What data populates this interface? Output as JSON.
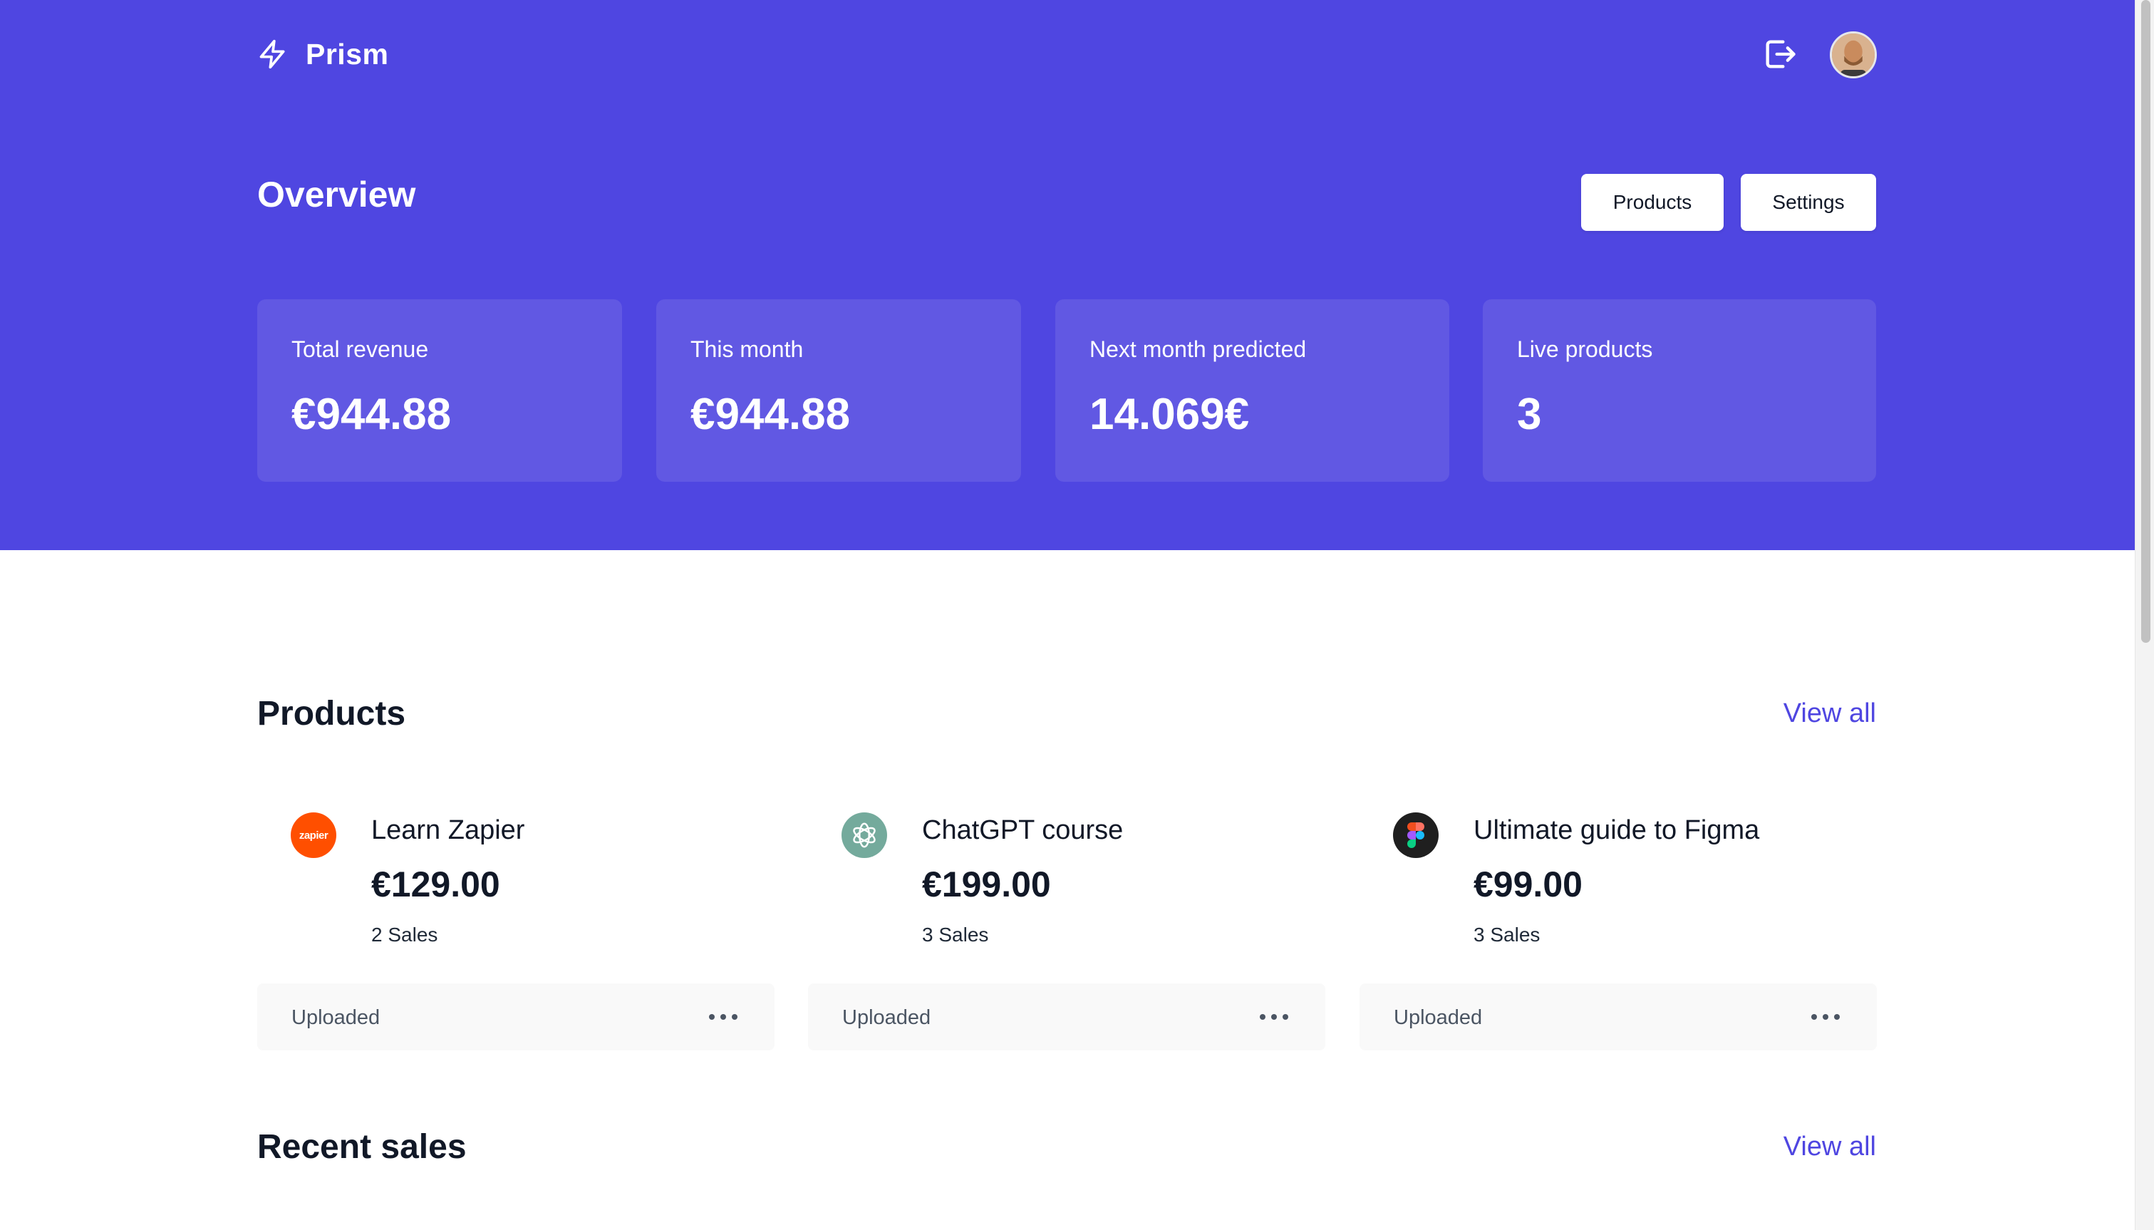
{
  "header": {
    "app_name": "Prism",
    "brand_icon": "lightning-bolt-icon",
    "logout_icon": "logout-icon",
    "avatar": "user-avatar"
  },
  "overview": {
    "title": "Overview",
    "buttons": {
      "products": "Products",
      "settings": "Settings"
    },
    "stats": [
      {
        "label": "Total revenue",
        "value": "€944.88"
      },
      {
        "label": "This month",
        "value": "€944.88"
      },
      {
        "label": "Next month predicted",
        "value": "14.069€"
      },
      {
        "label": "Live products",
        "value": "3"
      }
    ]
  },
  "products_section": {
    "title": "Products",
    "view_all": "View all",
    "items": [
      {
        "icon": "zapier-logo",
        "icon_text": "zapier",
        "name": "Learn Zapier",
        "price": "€129.00",
        "sales": "2 Sales",
        "status": "Uploaded"
      },
      {
        "icon": "chatgpt-logo",
        "name": "ChatGPT course",
        "price": "€199.00",
        "sales": "3 Sales",
        "status": "Uploaded"
      },
      {
        "icon": "figma-logo",
        "name": "Ultimate guide to Figma",
        "price": "€99.00",
        "sales": "3 Sales",
        "status": "Uploaded"
      }
    ]
  },
  "recent_sales_section": {
    "title": "Recent sales",
    "view_all": "View all"
  },
  "colors": {
    "hero_background": "#4f46e1",
    "stat_card_background": "#6158e3",
    "accent_link": "#4f46e1",
    "footer_background": "#f9f9f9"
  }
}
